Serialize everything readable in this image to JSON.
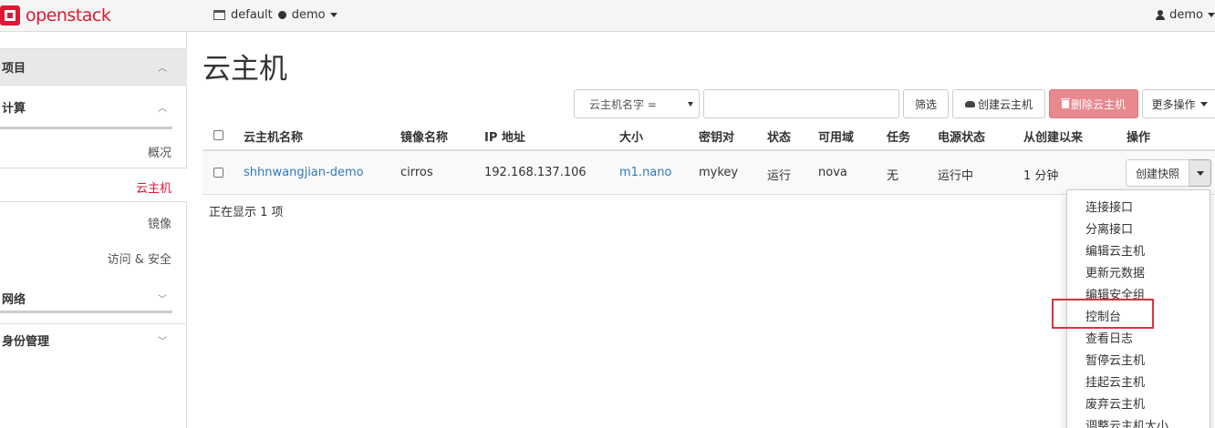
{
  "navbar": {
    "brand": "openstack",
    "domain": "default",
    "project": "demo",
    "user": "demo"
  },
  "sidebar": {
    "project_section": "项目",
    "compute_section": "计算",
    "compute_items": [
      "概况",
      "云主机",
      "镜像",
      "访问 & 安全"
    ],
    "active_item": "云主机",
    "network_section": "网络",
    "identity_section": "身份管理"
  },
  "page": {
    "title": "云主机"
  },
  "toolbar": {
    "filter_field": "云主机名字 =",
    "filter_value": "",
    "filter_button": "筛选",
    "create_button": "创建云主机",
    "delete_button": "删除云主机",
    "more_button": "更多操作"
  },
  "table": {
    "headers": [
      "云主机名称",
      "镜像名称",
      "IP 地址",
      "大小",
      "密钥对",
      "状态",
      "可用域",
      "任务",
      "电源状态",
      "从创建以来",
      "操作"
    ],
    "rows": [
      {
        "name": "shhnwangjian-demo",
        "image": "cirros",
        "ip": "192.168.137.106",
        "size": "m1.nano",
        "keypair": "mykey",
        "status": "运行",
        "zone": "nova",
        "task": "无",
        "power": "运行中",
        "age": "1 分钟",
        "action": "创建快照"
      }
    ],
    "footer": "正在显示 1 项"
  },
  "dropdown": {
    "items": [
      "连接接口",
      "分离接口",
      "编辑云主机",
      "更新元数据",
      "编辑安全组",
      "控制台",
      "查看日志",
      "暂停云主机",
      "挂起云主机",
      "废弃云主机",
      "调整云主机大小"
    ],
    "highlighted": "控制台"
  },
  "colors": {
    "brand": "#da1a32",
    "link": "#337ab7",
    "danger_button": "#e8888f",
    "highlight": "#d9343b"
  }
}
